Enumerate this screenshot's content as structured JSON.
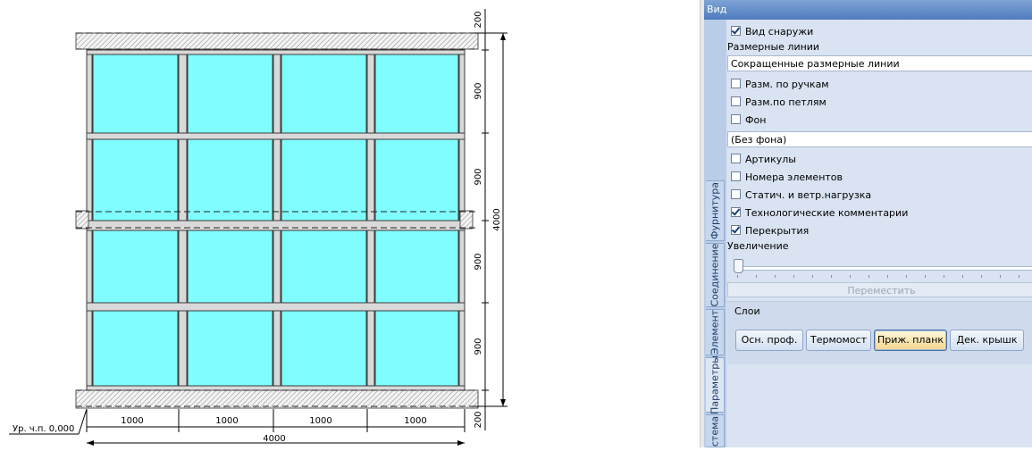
{
  "drawing": {
    "dims_top": [
      "1000",
      "1000",
      "1000",
      "1000"
    ],
    "dim_total_bottom": "4000",
    "dims_right": [
      "200",
      "900",
      "900",
      "900",
      "900",
      "200"
    ],
    "dim_total_right": "4000",
    "level_label": "Ур. ч.п. 0,000",
    "colors": {
      "glass": "#7ffdff",
      "frame": "#d9d9d9",
      "hatch": "#888888"
    }
  },
  "panel": {
    "header": "Вид",
    "tabs": [
      "Фурнитура",
      "Соединение",
      "Элемент",
      "Параметры",
      "стема"
    ],
    "view_outside": {
      "label": "Вид снаружи",
      "checked": true
    },
    "dim_lines_label": "Размерные линии",
    "dim_lines_value": "Сокращенные размерные линии",
    "dim_handles": {
      "label": "Разм. по ручкам",
      "checked": false
    },
    "dim_hinges": {
      "label": "Разм.по петлям",
      "checked": false
    },
    "background": {
      "label": "Фон",
      "checked": false
    },
    "background_value": "(Без фона)",
    "articles": {
      "label": "Артикулы",
      "checked": false
    },
    "element_numbers": {
      "label": "Номера элементов",
      "checked": false
    },
    "static_load": {
      "label": "Статич. и ветр.нагрузка",
      "checked": false
    },
    "tech_comments": {
      "label": "Технологические комментарии",
      "checked": true
    },
    "overlaps": {
      "label": "Перекрытия",
      "checked": true
    },
    "zoom_label": "Увеличение",
    "zoom_level": 0,
    "move_button": "Переместить",
    "layers_title": "Слои",
    "layer_buttons": [
      "Осн. проф.",
      "Термомост",
      "Приж. планк",
      "Дек. крышк"
    ],
    "active_layer": "Приж. планк"
  }
}
